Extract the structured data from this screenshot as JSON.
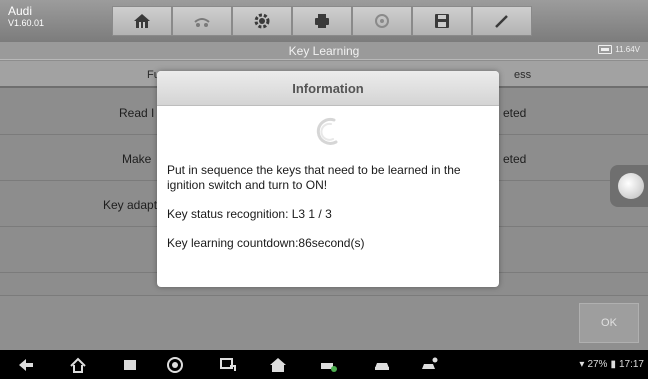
{
  "vehicle": {
    "make": "Audi",
    "version": "V1.60.01"
  },
  "toolbar": {
    "buttons": [
      {
        "icon": "home-icon"
      },
      {
        "icon": "vehicle-swap-icon"
      },
      {
        "icon": "settings-gear-icon"
      },
      {
        "icon": "print-icon"
      },
      {
        "icon": "help-icon"
      },
      {
        "icon": "save-icon"
      },
      {
        "icon": "edit-icon"
      }
    ]
  },
  "screen": {
    "title": "Key Learning",
    "battery_voltage": "11.64V"
  },
  "table": {
    "headers": {
      "function": "Fu",
      "status": "ess"
    },
    "rows": [
      {
        "function": "Read I",
        "status": "eted"
      },
      {
        "function": "Make",
        "status": "eted"
      },
      {
        "function": "Key adapt",
        "status": ""
      },
      {
        "function": "",
        "status": ""
      }
    ]
  },
  "ok_button": "OK",
  "dialog": {
    "title": "Information",
    "message": "Put in sequence the keys that need to be learned in the ignition switch and turn to ON!",
    "key_status": "Key status recognition: L3  1 / 3",
    "countdown": "Key learning countdown:86second(s)"
  },
  "system_status": {
    "battery": "27%",
    "time": "17:17"
  },
  "colors": {
    "dialog_bg": "#ffffff",
    "overlay": "#8d8d8d",
    "navbar": "#000000"
  }
}
